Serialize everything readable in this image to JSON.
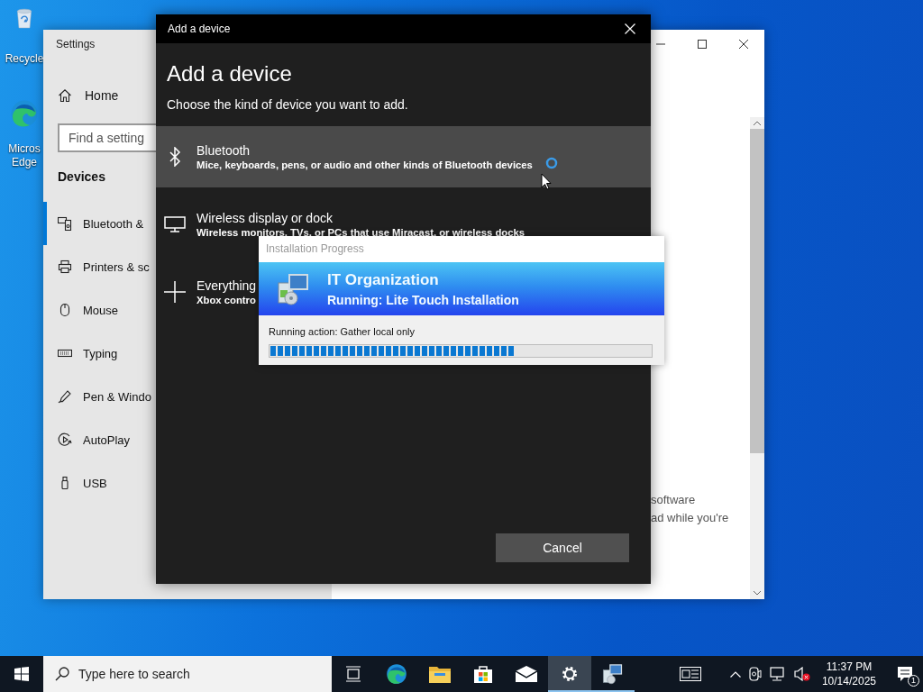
{
  "desktop_icons": [
    {
      "kind": "recycle",
      "lines": [
        "Recycle"
      ]
    },
    {
      "kind": "edge",
      "lines": [
        "Micros",
        "Edge"
      ]
    }
  ],
  "settings": {
    "title": "Settings",
    "home": "Home",
    "search": {
      "placeholder": "Find a setting"
    },
    "section": "Devices",
    "items": [
      {
        "kind": "bluetooth",
        "label": "Bluetooth &",
        "selected": true
      },
      {
        "kind": "printer",
        "label": "Printers & sc",
        "selected": false
      },
      {
        "kind": "mouse",
        "label": "Mouse",
        "selected": false
      },
      {
        "kind": "keyboard",
        "label": "Typing",
        "selected": false
      },
      {
        "kind": "pen",
        "label": "Pen & Windo",
        "selected": false
      },
      {
        "kind": "autoplay",
        "label": "AutoPlay",
        "selected": false
      },
      {
        "kind": "usb",
        "label": "USB",
        "selected": false
      }
    ],
    "content_lines": [
      "software",
      "ad while you're"
    ]
  },
  "dialog": {
    "title": "Add a device",
    "heading": "Add a device",
    "subtitle": "Choose the kind of device you want to add.",
    "options": [
      {
        "kind": "bluetooth",
        "title": "Bluetooth",
        "description": "Mice, keyboards, pens, or audio and other kinds of Bluetooth devices",
        "selected": true,
        "busy": true
      },
      {
        "kind": "display",
        "title": "Wireless display or dock",
        "description": "Wireless monitors, TVs, or PCs that use Miracast, or wireless docks",
        "selected": false
      },
      {
        "kind": "other",
        "title": "Everything",
        "description": "Xbox contro",
        "selected": false
      }
    ],
    "cancel": "Cancel"
  },
  "progress": {
    "title": "Installation Progress",
    "organization": "IT Organization",
    "status": "Running: Lite Touch Installation",
    "action": "Running action: Gather local only",
    "level": 0.64
  },
  "taskbar": {
    "search": {
      "placeholder": "Type here to search"
    },
    "apps": [
      {
        "kind": "taskview",
        "active": false,
        "open": false
      },
      {
        "kind": "edge",
        "active": false,
        "open": false
      },
      {
        "kind": "explorer",
        "active": false,
        "open": false
      },
      {
        "kind": "store",
        "active": false,
        "open": false
      },
      {
        "kind": "mail",
        "active": false,
        "open": false
      },
      {
        "kind": "settings",
        "active": true,
        "open": true
      },
      {
        "kind": "deploy",
        "active": false,
        "open": true
      }
    ],
    "time": "11:37 PM",
    "date": "10/14/2025",
    "notification_count": "1"
  }
}
